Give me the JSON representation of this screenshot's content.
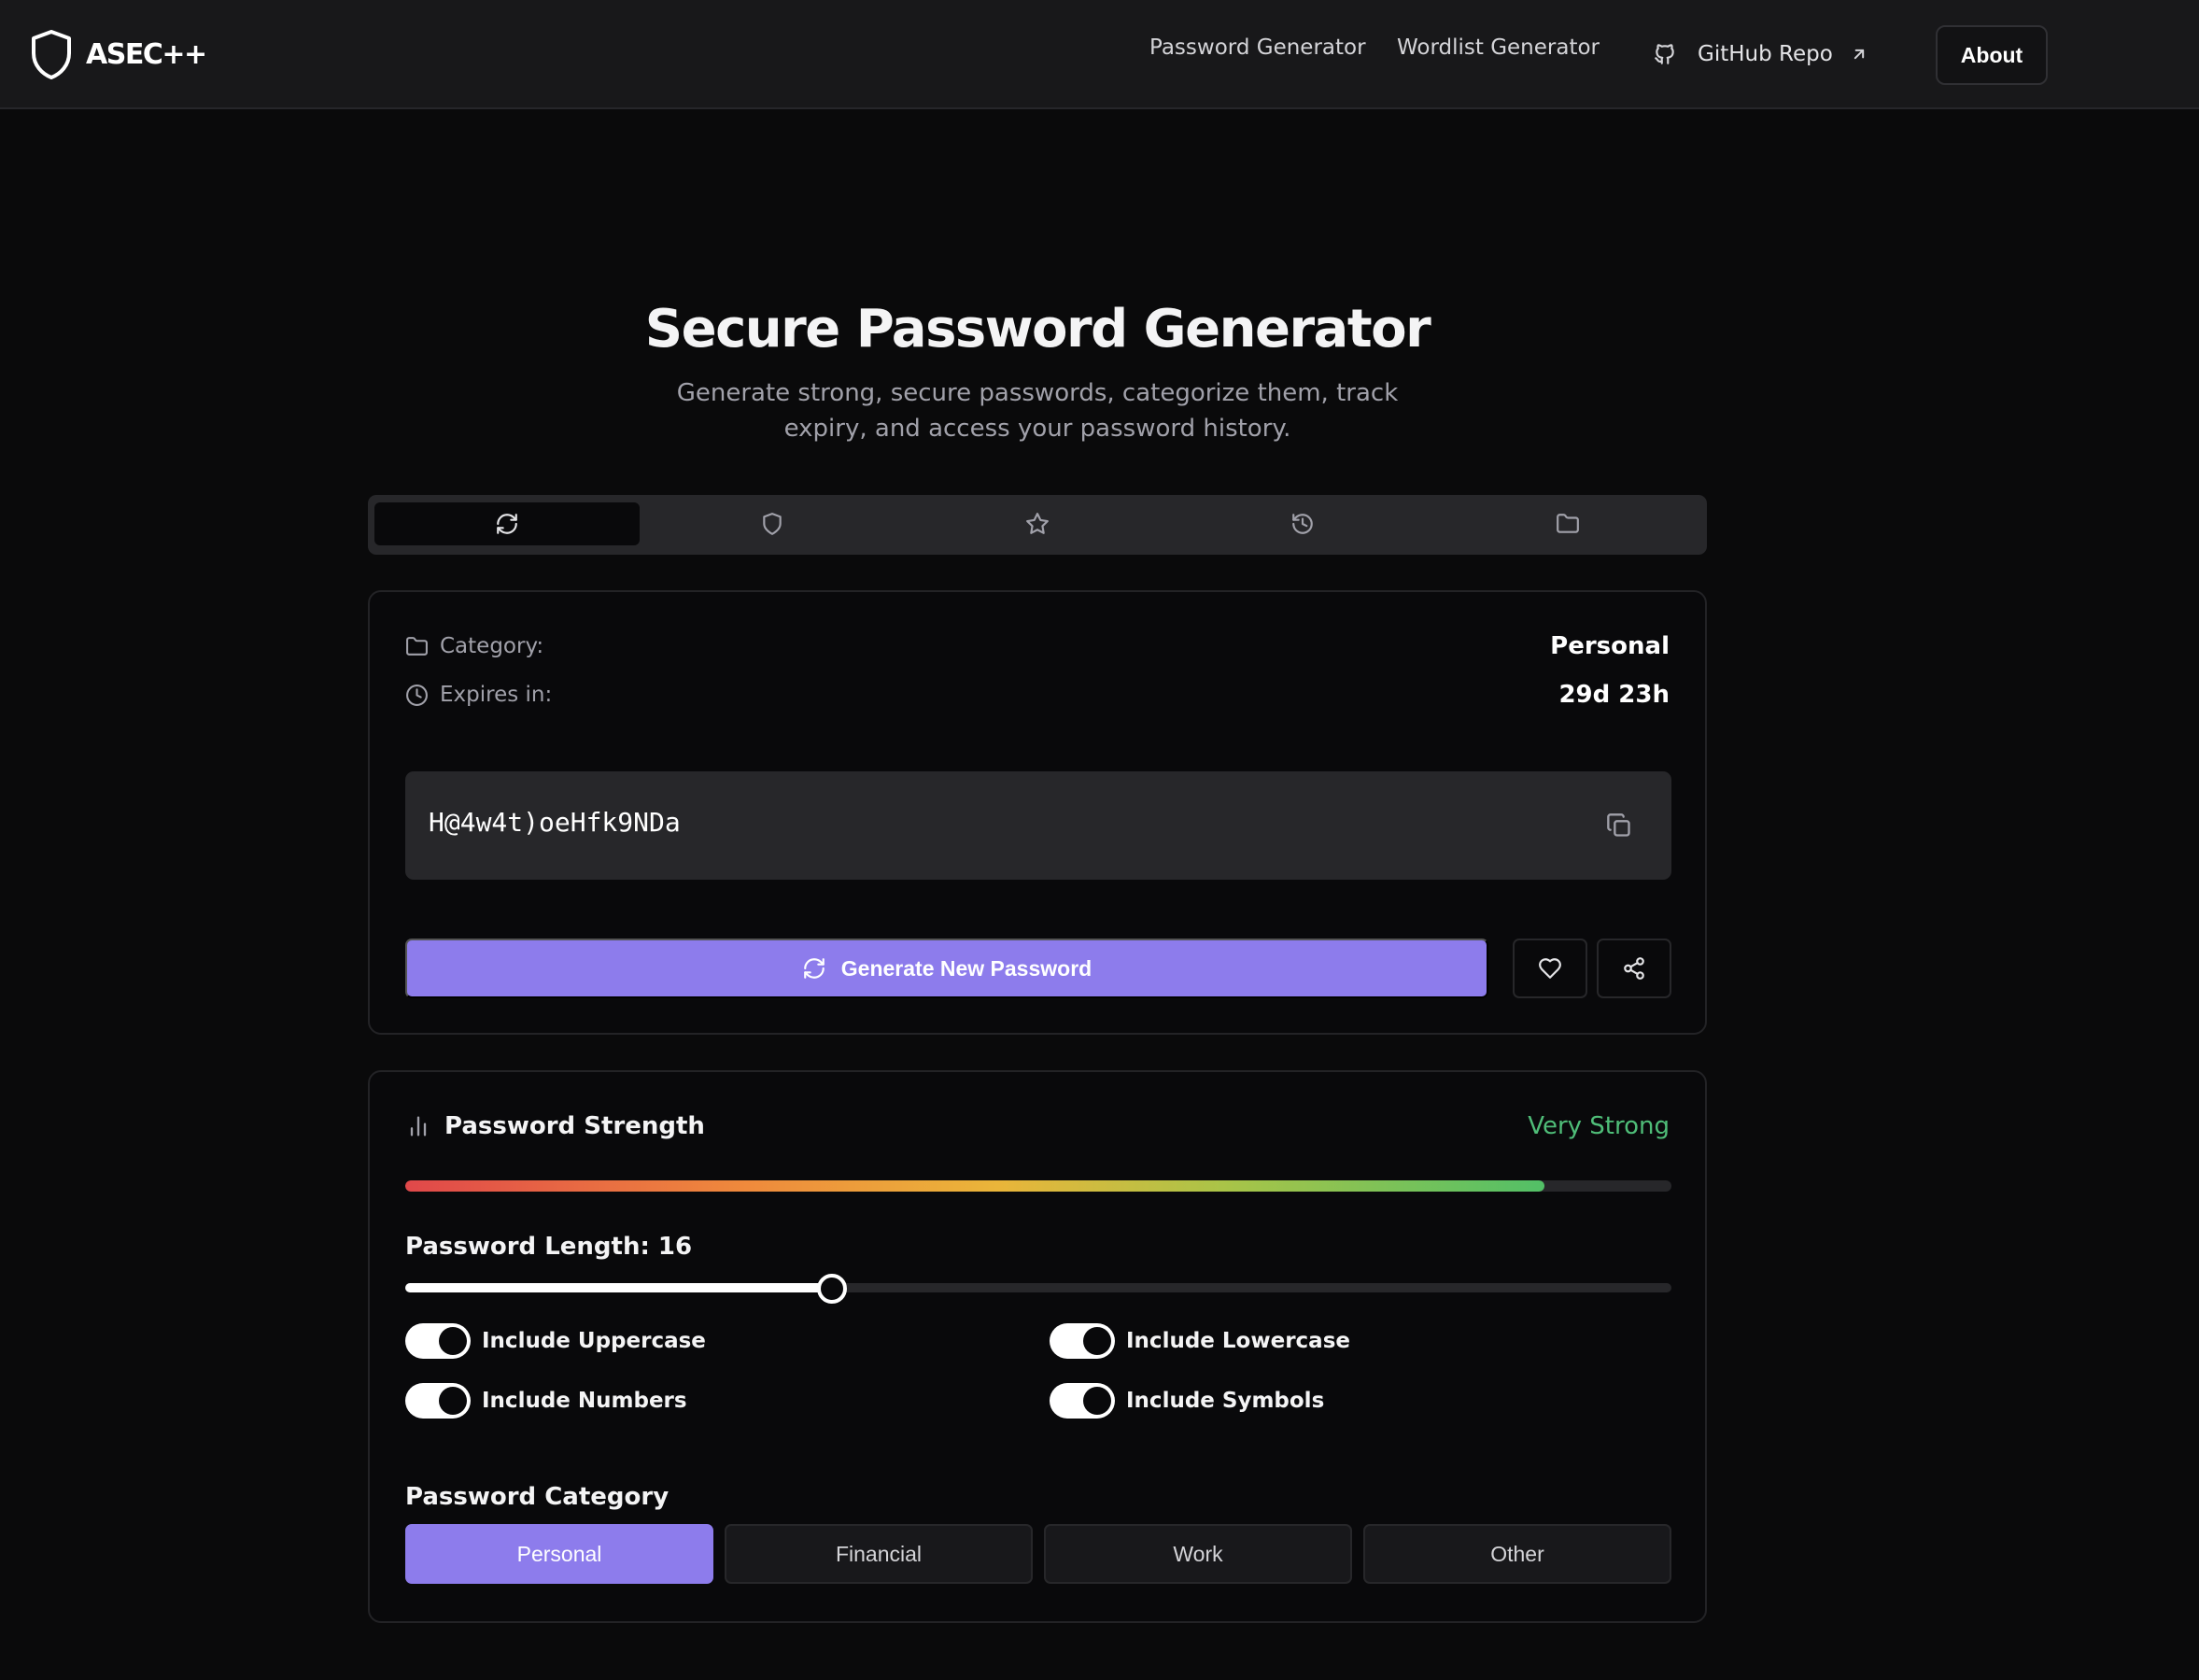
{
  "brand": {
    "name": "ASEC++",
    "icon": "shield-icon"
  },
  "nav": {
    "links": [
      {
        "label": "Password Generator"
      },
      {
        "label": "Wordlist Generator"
      }
    ],
    "github": {
      "label": "GitHub Repo",
      "icon": "github-icon",
      "external_icon": "arrow-up-right-icon"
    },
    "about": "About"
  },
  "hero": {
    "title": "Secure Password Generator",
    "subtitle": "Generate strong, secure passwords, categorize them, track expiry, and access your password history."
  },
  "tabs": [
    {
      "icon": "refresh-icon",
      "active": true
    },
    {
      "icon": "shield-icon",
      "active": false
    },
    {
      "icon": "star-icon",
      "active": false
    },
    {
      "icon": "history-icon",
      "active": false
    },
    {
      "icon": "folder-icon",
      "active": false
    }
  ],
  "generator": {
    "category_label": "Category:",
    "category_value": "Personal",
    "expires_label": "Expires in:",
    "expires_value": "29d 23h",
    "password": "H@4w4t)oeHfk9NDa",
    "generate_label": "Generate New Password"
  },
  "strength": {
    "title": "Password Strength",
    "rating": "Very Strong",
    "rating_color": "#4fbd78",
    "level": 0.9,
    "length_label": "Password Length: 16",
    "length_value": 16,
    "length_slider_fraction": 0.337
  },
  "options": [
    {
      "label": "Include Uppercase",
      "enabled": true
    },
    {
      "label": "Include Lowercase",
      "enabled": true
    },
    {
      "label": "Include Numbers",
      "enabled": true
    },
    {
      "label": "Include Symbols",
      "enabled": true
    }
  ],
  "category": {
    "title": "Password Category",
    "options": [
      "Personal",
      "Financial",
      "Work",
      "Other"
    ],
    "selected": "Personal"
  },
  "colors": {
    "accent": "#8d7cec",
    "background": "#0a0a0b",
    "card": "#09090b",
    "surface": "#27272a"
  }
}
